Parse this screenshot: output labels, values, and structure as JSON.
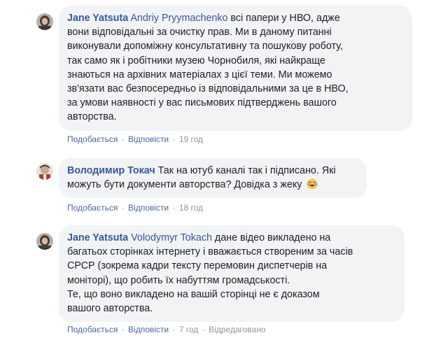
{
  "comments": [
    {
      "author": "Jane Yatsuta",
      "mention": "Andriy Pryymachenko",
      "lines": [
        " всі папери у НВО, адже",
        "вони відповідальні за очистку прав. Ми в даному питанні",
        "виконували допоміжну консультативну та пошукову роботу,",
        "так само як і робітники музею Чорнобиля, які найкраще",
        "знаються на архівних матеріалах з цієї теми. Ми можемо",
        "зв'язати вас безпосередньо із відповідальними за це в НВО,",
        "за умови наявності у вас письмових підтверджень вашого",
        "авторства."
      ],
      "like_label": "Подобається",
      "reply_label": "Відповісти",
      "time": "19 год"
    },
    {
      "author": "Володимир Токач",
      "lines": [
        " Так на ютуб каналі так і підписано. Які",
        "можуть бути документи авторства? Довідка з жеку"
      ],
      "emoji_icon": "laughing-tears-emoji",
      "like_label": "Подобається",
      "reply_label": "Відповісти",
      "time": "18 год"
    },
    {
      "author": "Jane Yatsuta",
      "mention": "Volodymyr Tokach",
      "lines": [
        " дане відео викладено на",
        "багатьох сторінках інтернету і вважається створеним за часів",
        "СРСР (зокрема кадри тексту перемовин диспетчерів на",
        "моніторі), що робить їх набуттям громадськості.",
        "Те, що воно викладено на вашій сторінці не є доказом",
        "вашого авторства."
      ],
      "like_label": "Подобається",
      "reply_label": "Відповісти",
      "time": "7 год",
      "edited": "Відредаговано"
    }
  ],
  "separator": "·",
  "colors": {
    "bubble": "#f2f3f5",
    "author": "#385898",
    "action_link": "#4b67a1",
    "meta": "#90949c"
  }
}
